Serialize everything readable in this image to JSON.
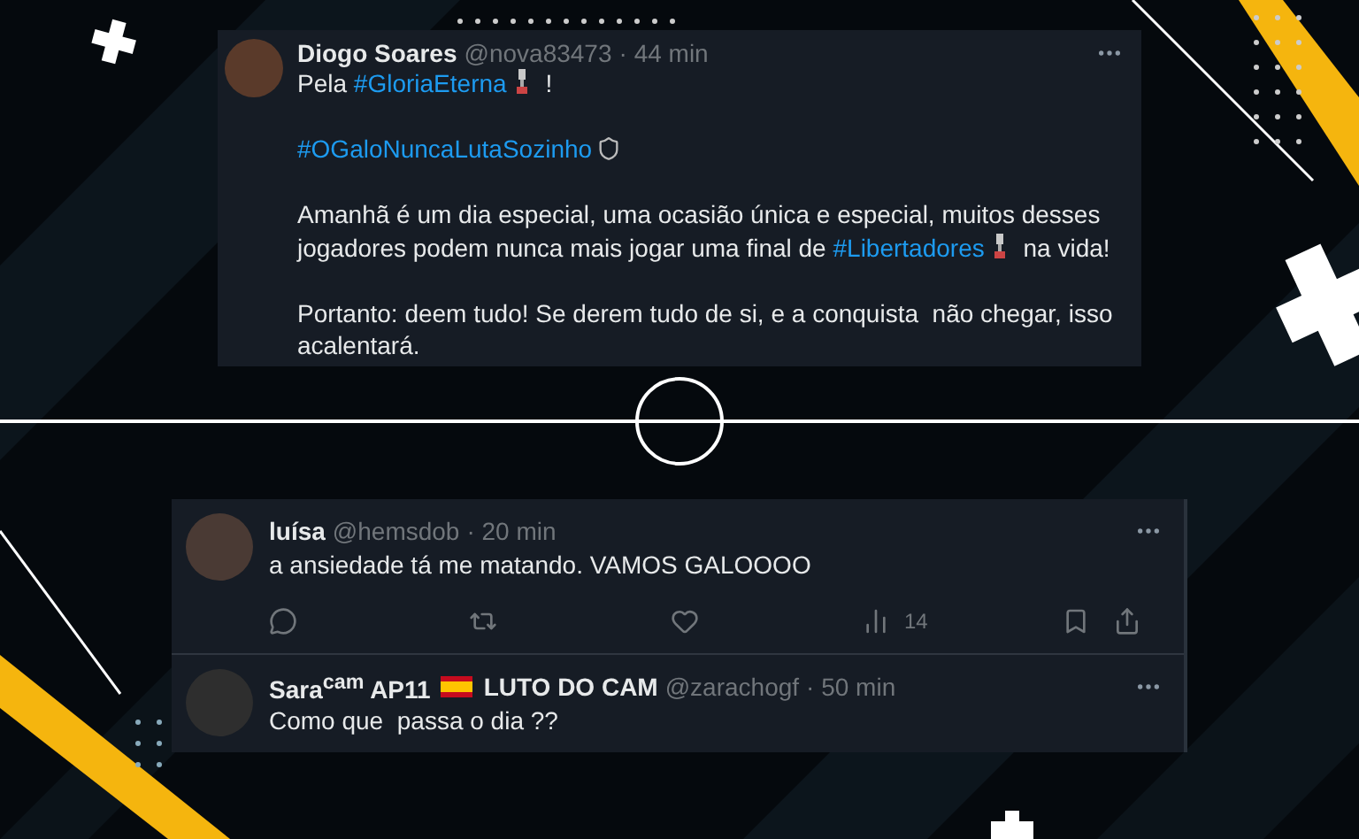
{
  "main_tweet": {
    "author": "Diogo Soares",
    "handle": "@nova83473",
    "time": "· 44 min",
    "paragraphs": [
      [
        {
          "kind": "text",
          "text": "Pela "
        },
        {
          "kind": "hashtag",
          "text": "#GloriaEterna"
        },
        {
          "kind": "trophy"
        },
        {
          "kind": "text",
          "text": " !"
        }
      ],
      [
        {
          "kind": "hashtag",
          "text": "#OGaloNuncaLutaSozinho"
        },
        {
          "kind": "crest"
        }
      ],
      [
        {
          "kind": "text",
          "text": "Amanhã é um dia especial, uma ocasião única e especial, muitos desses\njogadores podem nunca mais jogar uma final de "
        },
        {
          "kind": "hashtag",
          "text": "#Libertadores"
        },
        {
          "kind": "trophy"
        },
        {
          "kind": "text",
          "text": " na vida!"
        }
      ],
      [
        {
          "kind": "text",
          "text": "Portanto: deem tudo! Se derem tudo de si, e a conquista  não chegar, isso\nacalentará."
        }
      ]
    ]
  },
  "replies": [
    {
      "name": [
        {
          "kind": "text",
          "text": "luísa"
        }
      ],
      "handle": "@hemsdob",
      "time": "· 20 min",
      "text": "a ansiedade tá me matando. VAMOS GALOOOO",
      "actions": [
        {
          "kind": "reply"
        },
        {
          "kind": "retweet"
        },
        {
          "kind": "like"
        },
        {
          "kind": "views",
          "count": "14"
        },
        {
          "kind": "bookmark"
        },
        {
          "kind": "share"
        }
      ]
    },
    {
      "name": [
        {
          "kind": "text",
          "text": "Sara$^{cam}$ AP11"
        },
        {
          "kind": "flag"
        },
        {
          "kind": "text",
          "text": "LUTO DO CAM"
        }
      ],
      "handle": "@zarachogf",
      "time": "· 50 min",
      "text": "Como que  passa o dia ??"
    }
  ]
}
